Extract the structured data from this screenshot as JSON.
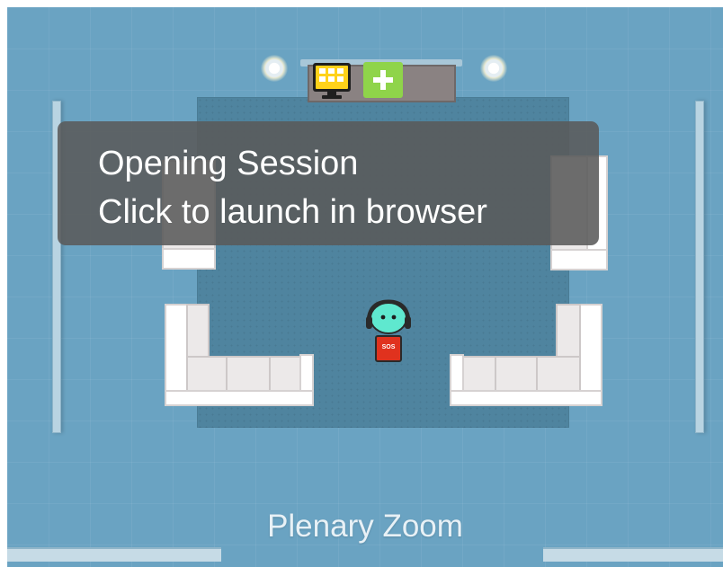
{
  "tooltip": {
    "line1": "Opening Session",
    "line2": "Click to launch in browser"
  },
  "room": {
    "label": "Plenary Zoom"
  },
  "avatar": {
    "badge": "SOS"
  },
  "objects": {
    "monitor_icon": "monitor-grid-icon",
    "plus_icon": "plus-icon",
    "lamp_icon": "lamp-icon"
  },
  "colors": {
    "floor": "#6aa3c2",
    "rug": "#4f849f",
    "tooltip_bg": "#5a5a5a",
    "plus_green": "#8fd44a",
    "avatar_teal": "#5fe8cf",
    "badge_red": "#e0321e"
  }
}
